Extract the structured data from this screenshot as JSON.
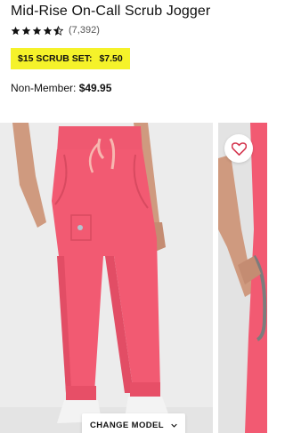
{
  "product": {
    "title": "Mid-Rise On-Call Scrub Jogger",
    "rating": 4.5,
    "rating_max": 5,
    "review_count": "(7,392)"
  },
  "promo": {
    "label": "$15 SCRUB SET:",
    "price": "$7.50",
    "background_color": "#f5f22a"
  },
  "pricing": {
    "label": "Non-Member:",
    "price": "$49.95"
  },
  "gallery": {
    "favorite_icon": "heart-icon",
    "change_model_label": "CHANGE MODEL",
    "change_model_icon": "chevron-down-icon",
    "product_color": "#f25a72"
  }
}
